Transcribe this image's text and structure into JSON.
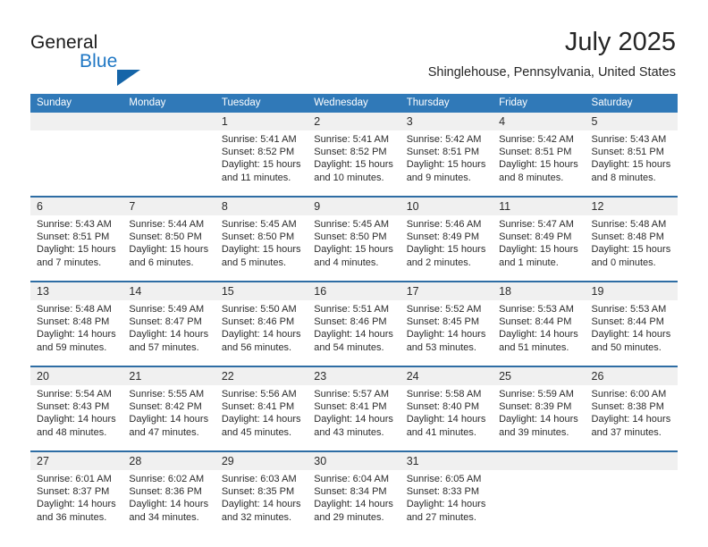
{
  "brand": {
    "name_part1": "General",
    "name_part2": "Blue",
    "accent_color": "#1f77c4",
    "triangle_color": "#1565a8"
  },
  "header": {
    "month_title": "July 2025",
    "location": "Shinglehouse, Pennsylvania, United States"
  },
  "calendar": {
    "header_bg": "#3079b8",
    "date_strip_bg": "#f0f0f0",
    "row_divider_color": "#2e6da4",
    "weekday_headers": [
      "Sunday",
      "Monday",
      "Tuesday",
      "Wednesday",
      "Thursday",
      "Friday",
      "Saturday"
    ],
    "weeks": [
      [
        {
          "day": "",
          "lines": []
        },
        {
          "day": "",
          "lines": []
        },
        {
          "day": "1",
          "lines": [
            "Sunrise: 5:41 AM",
            "Sunset: 8:52 PM",
            "Daylight: 15 hours",
            "and 11 minutes."
          ]
        },
        {
          "day": "2",
          "lines": [
            "Sunrise: 5:41 AM",
            "Sunset: 8:52 PM",
            "Daylight: 15 hours",
            "and 10 minutes."
          ]
        },
        {
          "day": "3",
          "lines": [
            "Sunrise: 5:42 AM",
            "Sunset: 8:51 PM",
            "Daylight: 15 hours",
            "and 9 minutes."
          ]
        },
        {
          "day": "4",
          "lines": [
            "Sunrise: 5:42 AM",
            "Sunset: 8:51 PM",
            "Daylight: 15 hours",
            "and 8 minutes."
          ]
        },
        {
          "day": "5",
          "lines": [
            "Sunrise: 5:43 AM",
            "Sunset: 8:51 PM",
            "Daylight: 15 hours",
            "and 8 minutes."
          ]
        }
      ],
      [
        {
          "day": "6",
          "lines": [
            "Sunrise: 5:43 AM",
            "Sunset: 8:51 PM",
            "Daylight: 15 hours",
            "and 7 minutes."
          ]
        },
        {
          "day": "7",
          "lines": [
            "Sunrise: 5:44 AM",
            "Sunset: 8:50 PM",
            "Daylight: 15 hours",
            "and 6 minutes."
          ]
        },
        {
          "day": "8",
          "lines": [
            "Sunrise: 5:45 AM",
            "Sunset: 8:50 PM",
            "Daylight: 15 hours",
            "and 5 minutes."
          ]
        },
        {
          "day": "9",
          "lines": [
            "Sunrise: 5:45 AM",
            "Sunset: 8:50 PM",
            "Daylight: 15 hours",
            "and 4 minutes."
          ]
        },
        {
          "day": "10",
          "lines": [
            "Sunrise: 5:46 AM",
            "Sunset: 8:49 PM",
            "Daylight: 15 hours",
            "and 2 minutes."
          ]
        },
        {
          "day": "11",
          "lines": [
            "Sunrise: 5:47 AM",
            "Sunset: 8:49 PM",
            "Daylight: 15 hours",
            "and 1 minute."
          ]
        },
        {
          "day": "12",
          "lines": [
            "Sunrise: 5:48 AM",
            "Sunset: 8:48 PM",
            "Daylight: 15 hours",
            "and 0 minutes."
          ]
        }
      ],
      [
        {
          "day": "13",
          "lines": [
            "Sunrise: 5:48 AM",
            "Sunset: 8:48 PM",
            "Daylight: 14 hours",
            "and 59 minutes."
          ]
        },
        {
          "day": "14",
          "lines": [
            "Sunrise: 5:49 AM",
            "Sunset: 8:47 PM",
            "Daylight: 14 hours",
            "and 57 minutes."
          ]
        },
        {
          "day": "15",
          "lines": [
            "Sunrise: 5:50 AM",
            "Sunset: 8:46 PM",
            "Daylight: 14 hours",
            "and 56 minutes."
          ]
        },
        {
          "day": "16",
          "lines": [
            "Sunrise: 5:51 AM",
            "Sunset: 8:46 PM",
            "Daylight: 14 hours",
            "and 54 minutes."
          ]
        },
        {
          "day": "17",
          "lines": [
            "Sunrise: 5:52 AM",
            "Sunset: 8:45 PM",
            "Daylight: 14 hours",
            "and 53 minutes."
          ]
        },
        {
          "day": "18",
          "lines": [
            "Sunrise: 5:53 AM",
            "Sunset: 8:44 PM",
            "Daylight: 14 hours",
            "and 51 minutes."
          ]
        },
        {
          "day": "19",
          "lines": [
            "Sunrise: 5:53 AM",
            "Sunset: 8:44 PM",
            "Daylight: 14 hours",
            "and 50 minutes."
          ]
        }
      ],
      [
        {
          "day": "20",
          "lines": [
            "Sunrise: 5:54 AM",
            "Sunset: 8:43 PM",
            "Daylight: 14 hours",
            "and 48 minutes."
          ]
        },
        {
          "day": "21",
          "lines": [
            "Sunrise: 5:55 AM",
            "Sunset: 8:42 PM",
            "Daylight: 14 hours",
            "and 47 minutes."
          ]
        },
        {
          "day": "22",
          "lines": [
            "Sunrise: 5:56 AM",
            "Sunset: 8:41 PM",
            "Daylight: 14 hours",
            "and 45 minutes."
          ]
        },
        {
          "day": "23",
          "lines": [
            "Sunrise: 5:57 AM",
            "Sunset: 8:41 PM",
            "Daylight: 14 hours",
            "and 43 minutes."
          ]
        },
        {
          "day": "24",
          "lines": [
            "Sunrise: 5:58 AM",
            "Sunset: 8:40 PM",
            "Daylight: 14 hours",
            "and 41 minutes."
          ]
        },
        {
          "day": "25",
          "lines": [
            "Sunrise: 5:59 AM",
            "Sunset: 8:39 PM",
            "Daylight: 14 hours",
            "and 39 minutes."
          ]
        },
        {
          "day": "26",
          "lines": [
            "Sunrise: 6:00 AM",
            "Sunset: 8:38 PM",
            "Daylight: 14 hours",
            "and 37 minutes."
          ]
        }
      ],
      [
        {
          "day": "27",
          "lines": [
            "Sunrise: 6:01 AM",
            "Sunset: 8:37 PM",
            "Daylight: 14 hours",
            "and 36 minutes."
          ]
        },
        {
          "day": "28",
          "lines": [
            "Sunrise: 6:02 AM",
            "Sunset: 8:36 PM",
            "Daylight: 14 hours",
            "and 34 minutes."
          ]
        },
        {
          "day": "29",
          "lines": [
            "Sunrise: 6:03 AM",
            "Sunset: 8:35 PM",
            "Daylight: 14 hours",
            "and 32 minutes."
          ]
        },
        {
          "day": "30",
          "lines": [
            "Sunrise: 6:04 AM",
            "Sunset: 8:34 PM",
            "Daylight: 14 hours",
            "and 29 minutes."
          ]
        },
        {
          "day": "31",
          "lines": [
            "Sunrise: 6:05 AM",
            "Sunset: 8:33 PM",
            "Daylight: 14 hours",
            "and 27 minutes."
          ]
        },
        {
          "day": "",
          "lines": []
        },
        {
          "day": "",
          "lines": []
        }
      ]
    ]
  }
}
